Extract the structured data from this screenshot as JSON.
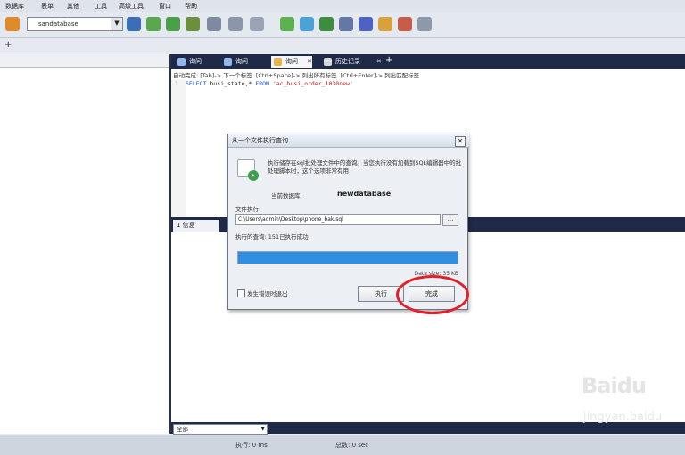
{
  "menu": {
    "items": [
      "数据库",
      "表单",
      "其他",
      "工具",
      "高级工具",
      "窗口",
      "帮助"
    ]
  },
  "toolbar": {
    "database_selected": "sandatabase",
    "icons": [
      "db-icon",
      "query-icon",
      "table-icon",
      "import-icon",
      "export-icon",
      "backup-icon",
      "restore-icon",
      "schedule-icon",
      "schema-icon",
      "sync-icon",
      "grid-icon",
      "report-icon",
      "wizard-icon",
      "tool-icon"
    ]
  },
  "toolbar2": {
    "add_label": "+"
  },
  "tabs": [
    {
      "label": "询问",
      "active": false
    },
    {
      "label": "询问",
      "active": false
    },
    {
      "label": "询问",
      "active": true,
      "closable": true
    },
    {
      "label": "历史记录",
      "active": false,
      "closable": true
    }
  ],
  "tab_add": "+",
  "editor": {
    "hint": "自动完成: [Tab]-> 下一个标签. [Ctrl+Space]-> 列出所有标签. [Ctrl+Enter]-> 列出匹配标签",
    "line_number": "1",
    "code_kw1": "SELECT",
    "code_mid": " busi_state,* ",
    "code_kw2": "FROM",
    "code_str": " 'ac_busi_order_1030new'"
  },
  "results": {
    "tab_label": "1 信息",
    "filter_value": "全部"
  },
  "status": {
    "exec": "执行: 0 ms",
    "total": "总数: 0 sec"
  },
  "dialog": {
    "title": "从一个文件执行查询",
    "close_label": "✕",
    "description": "执行储存在sql批处理文件中的查询。当您执行没有加载到SQL编辑器中的批处理脚本时，这个选项非常有用",
    "db_label": "当前数据库:",
    "db_name": "newdatabase",
    "file_label": "文件执行",
    "file_path": "C:\\Users\\admin\\Desktop\\phone_bak.sql",
    "browse_label": "...",
    "status_text": "执行的查询: 151已执行成功",
    "progress": 1.0,
    "data_size": "Data size: 35 KB",
    "abort_label": "发生错误时退出",
    "exec_button": "执行",
    "done_button": "完成"
  },
  "watermark": {
    "logo": "Baidu",
    "url": "jingyan.baidu"
  },
  "colors": {
    "dark_navy": "#1e2a47",
    "progress_blue": "#2f8fe0",
    "highlight_red": "#e0212b"
  }
}
